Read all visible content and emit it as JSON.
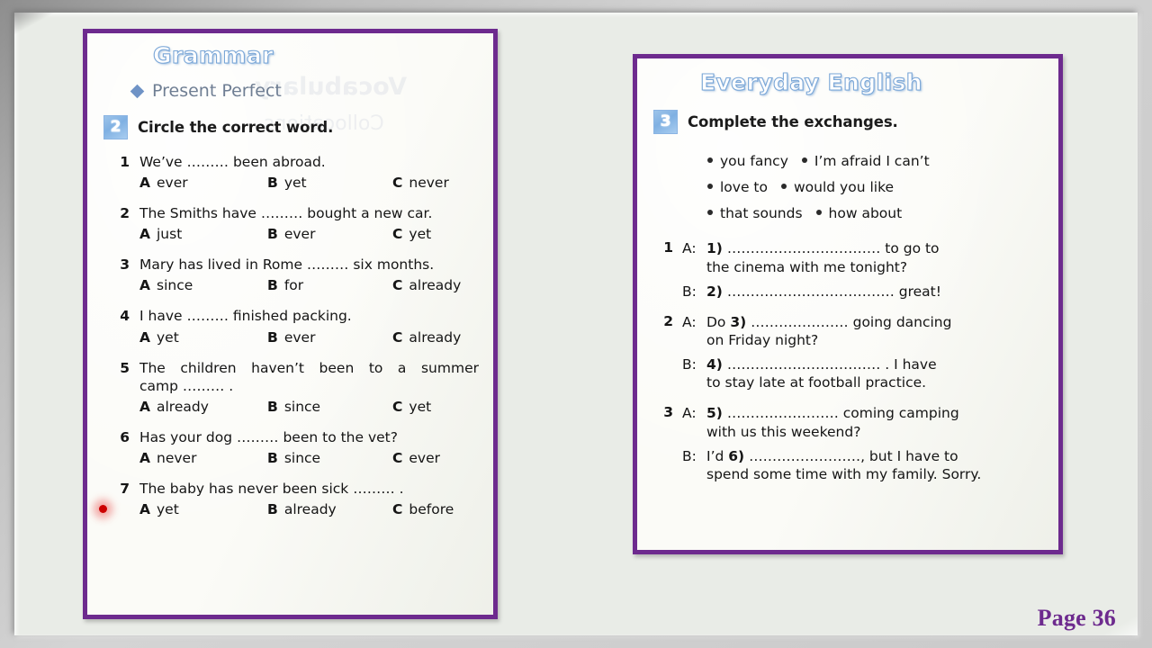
{
  "page_label": "Page 36",
  "colors": {
    "panel_border": "#6d2a8e",
    "title_outline": "#7ba7d7",
    "chip_blue": "#7fb0e2",
    "subhead_gray": "#6f7e93",
    "cursor_red": "#cc0000",
    "frame_gray": "#bdbdbd",
    "page_bg": "#e9ece7"
  },
  "left_panel": {
    "section_title": "Grammar",
    "subheading": "Present Perfect",
    "watermarks": [
      "Vocabulary",
      "Collocations"
    ],
    "exercise": {
      "number": "2",
      "instruction": "Circle the correct word."
    },
    "questions": [
      {
        "num": "1",
        "stem": "We’ve ……… been abroad.",
        "options": [
          {
            "letter": "A",
            "text": "ever"
          },
          {
            "letter": "B",
            "text": "yet"
          },
          {
            "letter": "C",
            "text": "never"
          }
        ]
      },
      {
        "num": "2",
        "stem": "The Smiths have ……… bought a new car.",
        "options": [
          {
            "letter": "A",
            "text": "just"
          },
          {
            "letter": "B",
            "text": "ever"
          },
          {
            "letter": "C",
            "text": "yet"
          }
        ]
      },
      {
        "num": "3",
        "stem": "Mary has lived in Rome ……… six months.",
        "options": [
          {
            "letter": "A",
            "text": "since"
          },
          {
            "letter": "B",
            "text": "for"
          },
          {
            "letter": "C",
            "text": "already"
          }
        ]
      },
      {
        "num": "4",
        "stem": "I have ……… finished packing.",
        "options": [
          {
            "letter": "A",
            "text": "yet"
          },
          {
            "letter": "B",
            "text": "ever"
          },
          {
            "letter": "C",
            "text": "already"
          }
        ]
      },
      {
        "num": "5",
        "stem_line1": "The children haven’t been to a summer",
        "stem_line2": "camp ……… .",
        "options": [
          {
            "letter": "A",
            "text": "already"
          },
          {
            "letter": "B",
            "text": "since"
          },
          {
            "letter": "C",
            "text": "yet"
          }
        ]
      },
      {
        "num": "6",
        "stem": "Has your dog ……… been to the vet?",
        "options": [
          {
            "letter": "A",
            "text": "never"
          },
          {
            "letter": "B",
            "text": "since"
          },
          {
            "letter": "C",
            "text": "ever"
          }
        ]
      },
      {
        "num": "7",
        "stem": "The baby has never been sick ……… .",
        "options": [
          {
            "letter": "A",
            "text": "yet"
          },
          {
            "letter": "B",
            "text": "already"
          },
          {
            "letter": "C",
            "text": "before"
          }
        ]
      }
    ]
  },
  "right_panel": {
    "section_title": "Everyday English",
    "exercise": {
      "number": "3",
      "instruction": "Complete the exchanges."
    },
    "word_bank": [
      [
        "you fancy",
        "I’m afraid I can’t"
      ],
      [
        "love to",
        "would you like"
      ],
      [
        "that sounds",
        "how about"
      ]
    ],
    "exchanges": [
      {
        "num": "1",
        "turns": [
          {
            "speaker": "A:",
            "slot": "1)",
            "dots": "……………………………",
            "line1_tail": " to go to",
            "line2": "the cinema with me tonight?"
          },
          {
            "speaker": "B:",
            "slot": "2)",
            "dots": "………………………………",
            "line1_tail": " great!",
            "line2": ""
          }
        ]
      },
      {
        "num": "2",
        "turns": [
          {
            "speaker": "A:",
            "prefix": "Do ",
            "slot": "3)",
            "dots": "…………………",
            "line1_tail": " going dancing",
            "line2": "on Friday night?"
          },
          {
            "speaker": "B:",
            "slot": "4)",
            "dots": "……………………………",
            "line1_tail": " . I have",
            "line2": "to stay late at football practice."
          }
        ]
      },
      {
        "num": "3",
        "turns": [
          {
            "speaker": "A:",
            "slot": "5)",
            "dots": "……………………",
            "line1_tail": " coming camping",
            "line2": "with us this weekend?"
          },
          {
            "speaker": "B:",
            "prefix": "I’d ",
            "slot": "6)",
            "dots": "……………………",
            "line1_tail": ", but I have to",
            "line2": "spend some time with my family. Sorry."
          }
        ]
      }
    ]
  }
}
